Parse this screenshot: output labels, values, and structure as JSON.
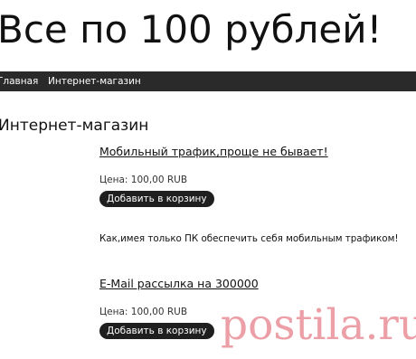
{
  "site": {
    "title": "Все по 100 рублей!"
  },
  "nav": {
    "items": [
      {
        "label": "Главная"
      },
      {
        "label": "Интернет-магазин"
      }
    ]
  },
  "section": {
    "title": "Интернет-магазин"
  },
  "products": [
    {
      "title": "Мобильный трафик,проще не бывает!",
      "price": "Цена: 100,00 RUB",
      "button": "Добавить в корзину",
      "description": "Как,имея только ПК обеспечить себя мобильным трафиком!"
    },
    {
      "title": "E-Mail рассылка на 300000",
      "price": "Цена: 100,00 RUB",
      "button": "Добавить в корзину"
    }
  ],
  "watermark": {
    "text": "postila.ru",
    "color": "#dc505f"
  }
}
